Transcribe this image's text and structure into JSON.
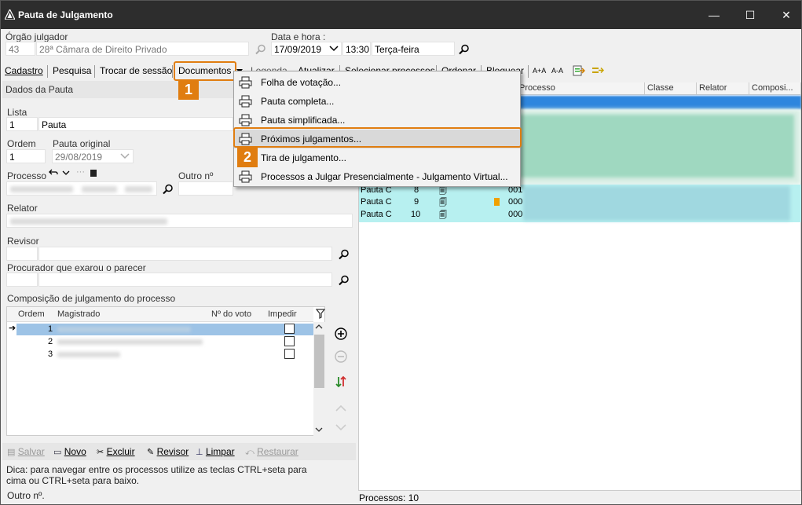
{
  "window": {
    "title": "Pauta de Julgamento",
    "minimize": "—",
    "maximize": "☐",
    "close": "✕"
  },
  "header": {
    "orgao_label": "Órgão julgador",
    "orgao_code": "43",
    "orgao_name": "28ª Câmara de Direito Privado",
    "data_hora_label": "Data e hora :",
    "date": "17/09/2019",
    "time": "13:30",
    "weekday": "Terça-feira"
  },
  "toolbar": {
    "cadastro": "Cadastro",
    "pesquisa": "Pesquisa",
    "trocar": "Trocar de sessão",
    "documentos": "Documentos",
    "legenda": "Legenda",
    "atualizar": "Atualizar",
    "selecionar": "Selecionar processos",
    "ordenar": "Ordenar",
    "bloquear": "Bloquear",
    "font_inc": "A+A",
    "font_dec": "A-A"
  },
  "left": {
    "panel_title": "Dados da Pauta",
    "lista_label": "Lista",
    "lista_code": "1",
    "lista_value": "Pauta",
    "ordem_label": "Ordem",
    "ordem_value": "1",
    "pauta_original_label": "Pauta original",
    "pauta_original_value": "29/08/2019",
    "processo_label": "Processo",
    "outro_label": "Outro nº",
    "relator_label": "Relator",
    "revisor_label": "Revisor",
    "procurador_label": "Procurador que exarou o parecer",
    "composicao_label": "Composição de julgamento do processo",
    "grid_cols": [
      "Ordem",
      "Magistrado",
      "Nº do voto",
      "Impedir"
    ],
    "grid_rows": [
      "1",
      "2",
      "3"
    ],
    "actions": {
      "salvar": "Salvar",
      "novo": "Novo",
      "excluir": "Excluir",
      "revisor": "Revisor",
      "limpar": "Limpar",
      "restaurar": "Restaurar"
    },
    "dica": "Dica: para navegar entre os processos utilize as teclas CTRL+seta para cima ou CTRL+seta para baixo.",
    "outro_n": "Outro nº."
  },
  "right": {
    "cols": [
      "Processo",
      "Classe",
      "Relator",
      "Composi..."
    ],
    "rows": [
      {
        "lista": "Pauta C",
        "ordem": "8",
        "num": "001"
      },
      {
        "lista": "Pauta C",
        "ordem": "9",
        "num": "000"
      },
      {
        "lista": "Pauta C",
        "ordem": "10",
        "num": "000"
      }
    ],
    "footer": "Processos: 10"
  },
  "menu": {
    "items": [
      "Folha de votação...",
      "Pauta completa...",
      "Pauta simplificada...",
      "Próximos julgamentos...",
      "Tira de julgamento...",
      "Processos a Julgar Presencialmente - Julgamento Virtual..."
    ]
  },
  "badges": {
    "one": "1",
    "two": "2"
  },
  "colors": {
    "accent": "#e07d10",
    "selected": "#9dc3e6",
    "row_cyan": "#b7f0f0",
    "titlebar": "#2d2d2d"
  }
}
